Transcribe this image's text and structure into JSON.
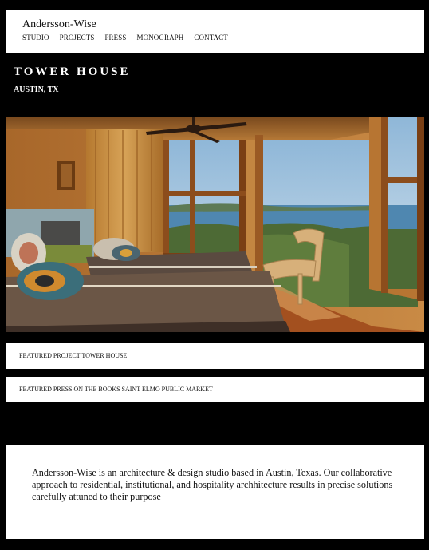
{
  "site": {
    "logo": "Andersson-Wise",
    "nav": [
      "STUDIO",
      "PROJECTS",
      "PRESS",
      "MONOGRAPH",
      "CONTACT"
    ]
  },
  "project": {
    "title": "TOWER HOUSE",
    "location": "AUSTIN, TX"
  },
  "featured": {
    "project_label": "FEATURED PROJECT TOWER HOUSE",
    "press_label": "FEATURED PRESS ON THE BOOKS SAINT ELMO PUBLIC MARKET"
  },
  "about": {
    "text": "Andersson-Wise is an architecture & design studio based in Austin, Texas. Our collaborative approach to residential, institutional, and hospitality archhitecture results in precise solutions carefully attuned to their purpose"
  },
  "colors": {
    "page_background": "#000000",
    "panel_background": "#ffffff",
    "text": "#111111"
  }
}
